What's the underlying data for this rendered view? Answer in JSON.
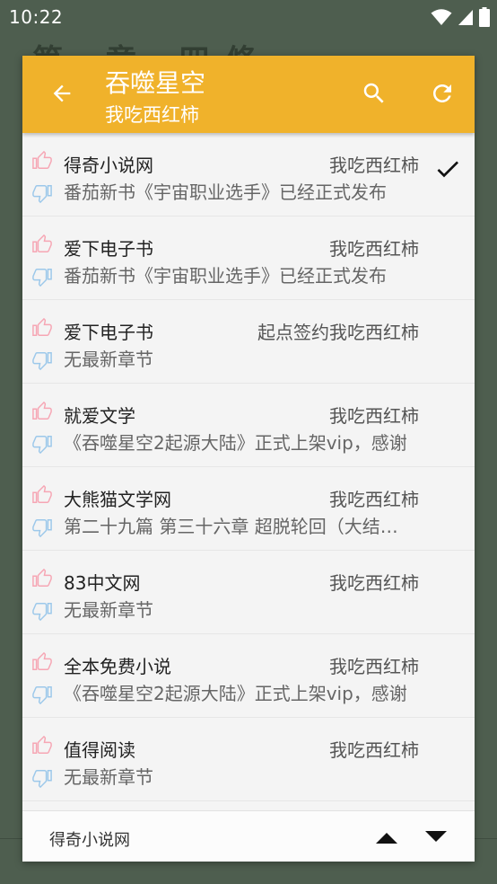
{
  "status_bar": {
    "time": "10:22"
  },
  "background": {
    "chapter_title": "第 章 四脩"
  },
  "toolbar": {
    "title": "吞噬星空",
    "subtitle": "我吃西红柿"
  },
  "sources": [
    {
      "origin": "得奇小说网",
      "author": "我吃西红柿",
      "latest": "番茄新书《宇宙职业选手》已经正式发布",
      "selected": true
    },
    {
      "origin": "爱下电子书",
      "author": "我吃西红柿",
      "latest": "番茄新书《宇宙职业选手》已经正式发布",
      "selected": false
    },
    {
      "origin": "爱下电子书",
      "author": "起点签约我吃西红柿",
      "latest": "无最新章节",
      "selected": false
    },
    {
      "origin": "就爱文学",
      "author": "我吃西红柿",
      "latest": "《吞噬星空2起源大陆》正式上架vip，感谢",
      "selected": false
    },
    {
      "origin": "大熊猫文学网",
      "author": "我吃西红柿",
      "latest": "第二十九篇 第三十六章 超脱轮回（大结局）",
      "selected": false
    },
    {
      "origin": "83中文网",
      "author": "我吃西红柿",
      "latest": "无最新章节",
      "selected": false
    },
    {
      "origin": "全本免费小说",
      "author": "我吃西红柿",
      "latest": "《吞噬星空2起源大陆》正式上架vip，感谢",
      "selected": false
    },
    {
      "origin": "值得阅读",
      "author": "我吃西红柿",
      "latest": "无最新章节",
      "selected": false
    }
  ],
  "bottom_bar": {
    "current_source": "得奇小说网"
  },
  "colors": {
    "accent": "#f0b22b",
    "thumb_up": "#f6a6b4",
    "thumb_down": "#9cc8ea",
    "background": "#4e5e4f"
  },
  "icons": {
    "back": "arrow-left-icon",
    "search": "search-icon",
    "refresh": "refresh-icon",
    "selected": "check-icon",
    "thumb_up": "thumb-up-icon",
    "thumb_down": "thumb-down-icon",
    "up": "triangle-up-icon",
    "down": "triangle-down-icon"
  }
}
